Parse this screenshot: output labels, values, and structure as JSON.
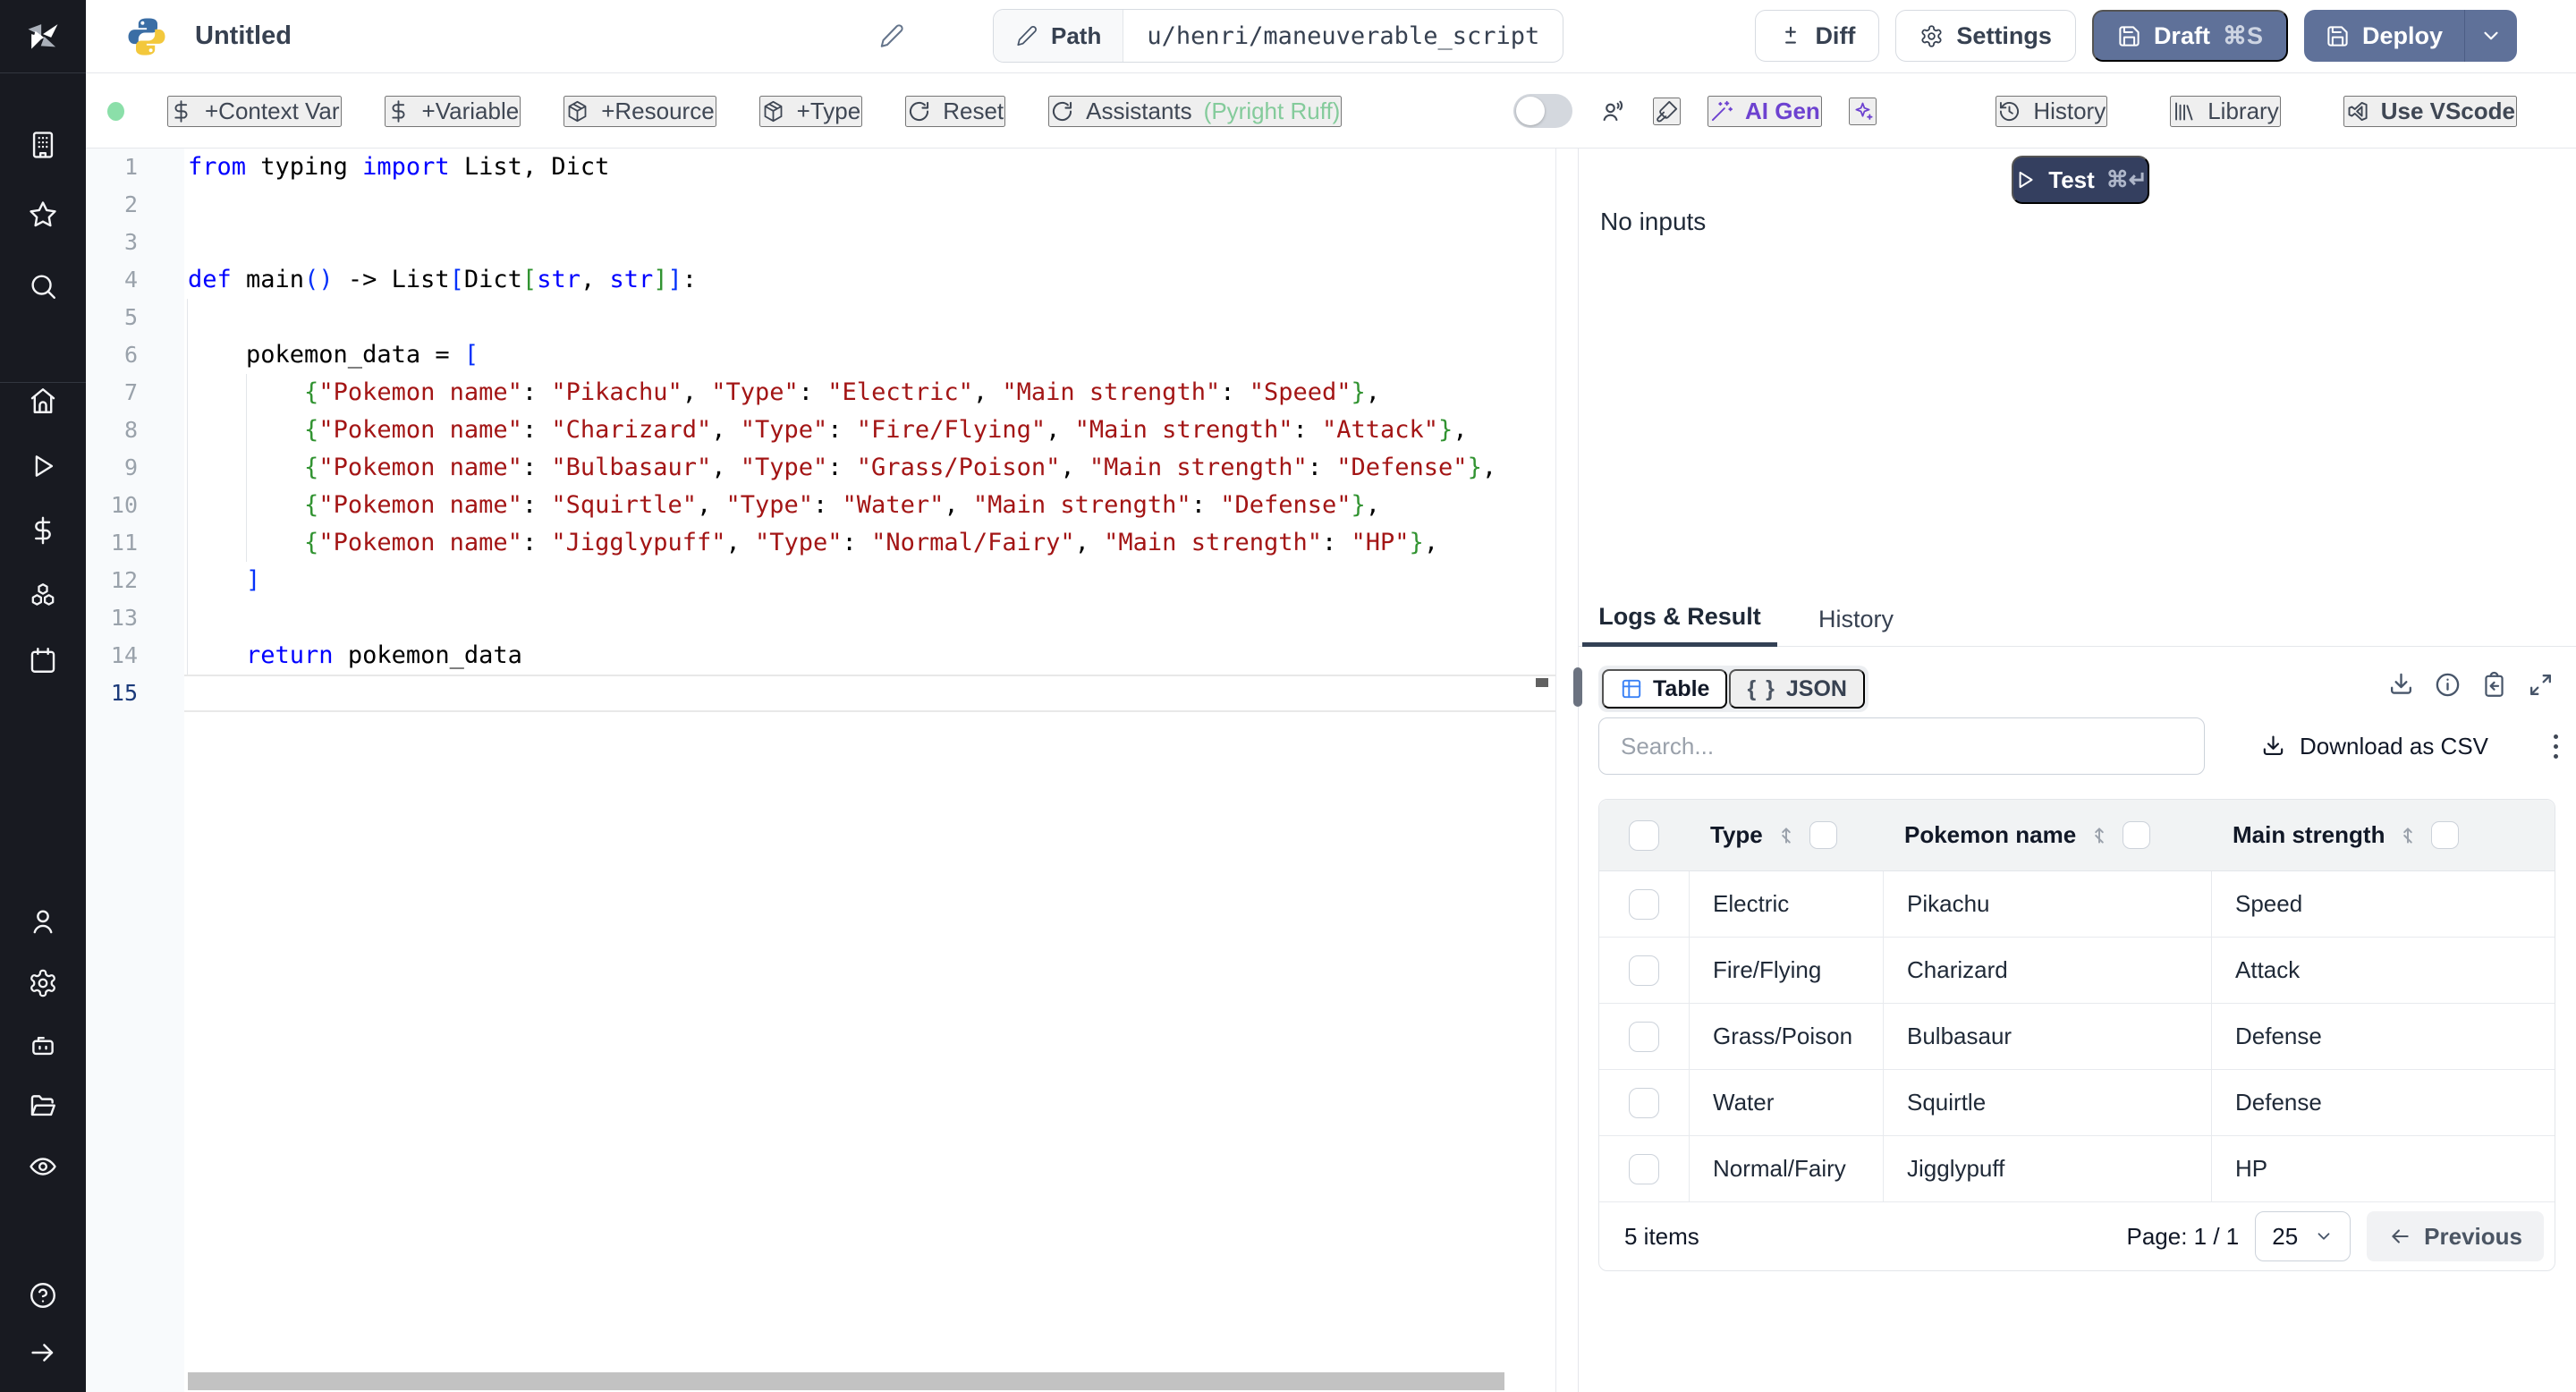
{
  "topbar": {
    "title": "Untitled",
    "path_label": "Path",
    "path_value": "u/henri/maneuverable_script",
    "diff": "Diff",
    "settings": "Settings",
    "draft": "Draft",
    "draft_shortcut": "⌘S",
    "deploy": "Deploy"
  },
  "toolbar": {
    "context_var": "+Context Var",
    "variable": "+Variable",
    "resource": "+Resource",
    "type": "+Type",
    "reset": "Reset",
    "assistants": "Assistants",
    "assistants_langs": "(Pyright Ruff)",
    "ai_gen": "AI Gen",
    "history": "History",
    "library": "Library",
    "use_vscode": "Use VScode"
  },
  "run": {
    "test": "Test",
    "test_shortcut": "⌘↵",
    "no_inputs": "No inputs"
  },
  "tabs": {
    "logs": "Logs & Result",
    "history": "History"
  },
  "result": {
    "view_table": "Table",
    "view_json": "JSON",
    "json_glyph": "{ }",
    "search_placeholder": "Search...",
    "download_csv": "Download as CSV",
    "columns": [
      "Type",
      "Pokemon name",
      "Main strength"
    ],
    "rows": [
      [
        "Electric",
        "Pikachu",
        "Speed"
      ],
      [
        "Fire/Flying",
        "Charizard",
        "Attack"
      ],
      [
        "Grass/Poison",
        "Bulbasaur",
        "Defense"
      ],
      [
        "Water",
        "Squirtle",
        "Defense"
      ],
      [
        "Normal/Fairy",
        "Jigglypuff",
        "HP"
      ]
    ],
    "footer": {
      "items": "5 items",
      "page": "Page: 1 / 1",
      "page_size": "25",
      "previous": "Previous"
    }
  },
  "editor": {
    "language": "python",
    "current_line": 15,
    "lines": [
      {
        "n": 1,
        "seg": [
          [
            "k",
            "from"
          ],
          [
            "t",
            " typing "
          ],
          [
            "k",
            "import"
          ],
          [
            "t",
            " List, Dict"
          ]
        ]
      },
      {
        "n": 2,
        "seg": []
      },
      {
        "n": 3,
        "seg": []
      },
      {
        "n": 4,
        "seg": [
          [
            "k",
            "def"
          ],
          [
            "t",
            " main"
          ],
          [
            "b",
            "()"
          ],
          [
            "t",
            " -> List"
          ],
          [
            "b",
            "["
          ],
          [
            "t",
            "Dict"
          ],
          [
            "g",
            "["
          ],
          [
            "k",
            "str"
          ],
          [
            "t",
            ", "
          ],
          [
            "k",
            "str"
          ],
          [
            "g",
            "]"
          ],
          [
            "b",
            "]"
          ],
          [
            "t",
            ":"
          ]
        ]
      },
      {
        "n": 5,
        "seg": []
      },
      {
        "n": 6,
        "seg": [
          [
            "t",
            "    pokemon_data = "
          ],
          [
            "b",
            "["
          ]
        ]
      },
      {
        "n": 7,
        "seg": [
          [
            "t",
            "        "
          ],
          [
            "g",
            "{"
          ],
          [
            "s",
            "\"Pokemon name\""
          ],
          [
            "t",
            ": "
          ],
          [
            "s",
            "\"Pikachu\""
          ],
          [
            "t",
            ", "
          ],
          [
            "s",
            "\"Type\""
          ],
          [
            "t",
            ": "
          ],
          [
            "s",
            "\"Electric\""
          ],
          [
            "t",
            ", "
          ],
          [
            "s",
            "\"Main strength\""
          ],
          [
            "t",
            ": "
          ],
          [
            "s",
            "\"Speed\""
          ],
          [
            "g",
            "}"
          ],
          [
            "t",
            ","
          ]
        ]
      },
      {
        "n": 8,
        "seg": [
          [
            "t",
            "        "
          ],
          [
            "g",
            "{"
          ],
          [
            "s",
            "\"Pokemon name\""
          ],
          [
            "t",
            ": "
          ],
          [
            "s",
            "\"Charizard\""
          ],
          [
            "t",
            ", "
          ],
          [
            "s",
            "\"Type\""
          ],
          [
            "t",
            ": "
          ],
          [
            "s",
            "\"Fire/Flying\""
          ],
          [
            "t",
            ", "
          ],
          [
            "s",
            "\"Main strength\""
          ],
          [
            "t",
            ": "
          ],
          [
            "s",
            "\"Attack\""
          ],
          [
            "g",
            "}"
          ],
          [
            "t",
            ","
          ]
        ]
      },
      {
        "n": 9,
        "seg": [
          [
            "t",
            "        "
          ],
          [
            "g",
            "{"
          ],
          [
            "s",
            "\"Pokemon name\""
          ],
          [
            "t",
            ": "
          ],
          [
            "s",
            "\"Bulbasaur\""
          ],
          [
            "t",
            ", "
          ],
          [
            "s",
            "\"Type\""
          ],
          [
            "t",
            ": "
          ],
          [
            "s",
            "\"Grass/Poison\""
          ],
          [
            "t",
            ", "
          ],
          [
            "s",
            "\"Main strength\""
          ],
          [
            "t",
            ": "
          ],
          [
            "s",
            "\"Defense\""
          ],
          [
            "g",
            "}"
          ],
          [
            "t",
            ","
          ]
        ]
      },
      {
        "n": 10,
        "seg": [
          [
            "t",
            "        "
          ],
          [
            "g",
            "{"
          ],
          [
            "s",
            "\"Pokemon name\""
          ],
          [
            "t",
            ": "
          ],
          [
            "s",
            "\"Squirtle\""
          ],
          [
            "t",
            ", "
          ],
          [
            "s",
            "\"Type\""
          ],
          [
            "t",
            ": "
          ],
          [
            "s",
            "\"Water\""
          ],
          [
            "t",
            ", "
          ],
          [
            "s",
            "\"Main strength\""
          ],
          [
            "t",
            ": "
          ],
          [
            "s",
            "\"Defense\""
          ],
          [
            "g",
            "}"
          ],
          [
            "t",
            ","
          ]
        ]
      },
      {
        "n": 11,
        "seg": [
          [
            "t",
            "        "
          ],
          [
            "g",
            "{"
          ],
          [
            "s",
            "\"Pokemon name\""
          ],
          [
            "t",
            ": "
          ],
          [
            "s",
            "\"Jigglypuff\""
          ],
          [
            "t",
            ", "
          ],
          [
            "s",
            "\"Type\""
          ],
          [
            "t",
            ": "
          ],
          [
            "s",
            "\"Normal/Fairy\""
          ],
          [
            "t",
            ", "
          ],
          [
            "s",
            "\"Main strength\""
          ],
          [
            "t",
            ": "
          ],
          [
            "s",
            "\"HP\""
          ],
          [
            "g",
            "}"
          ],
          [
            "t",
            ","
          ]
        ]
      },
      {
        "n": 12,
        "seg": [
          [
            "t",
            "    "
          ],
          [
            "b",
            "]"
          ]
        ]
      },
      {
        "n": 13,
        "seg": []
      },
      {
        "n": 14,
        "seg": [
          [
            "t",
            "    "
          ],
          [
            "k",
            "return"
          ],
          [
            "t",
            " pokemon_data"
          ]
        ]
      },
      {
        "n": 15,
        "seg": []
      }
    ]
  },
  "colors": {
    "accent_slate": "#5f7199",
    "test_button": "#343f5f",
    "ai_purple": "#6d42d0",
    "assist_green": "#84cb9b",
    "ok_green": "#8bdfa9",
    "keyword": "#0000ff",
    "string": "#a31515",
    "bracket_blue": "#0431fa",
    "bracket_green": "#319331",
    "table_icon_blue": "#3b82f6"
  },
  "icons": [
    "windmill-logo",
    "buildings",
    "star",
    "search",
    "home",
    "play",
    "dollar",
    "boxes",
    "calendar",
    "user",
    "gear",
    "robot",
    "folder-open",
    "eye",
    "help-circle",
    "arrow-right",
    "python-logo",
    "pencil",
    "diff",
    "gear",
    "save",
    "chevron-down",
    "reset-rotate",
    "users",
    "paintbrush",
    "magic-wand",
    "sparkles",
    "history-clock",
    "library",
    "vscode",
    "download",
    "info",
    "clipboard-copy",
    "expand",
    "kebab-menu",
    "sort-updown",
    "arrow-left"
  ]
}
